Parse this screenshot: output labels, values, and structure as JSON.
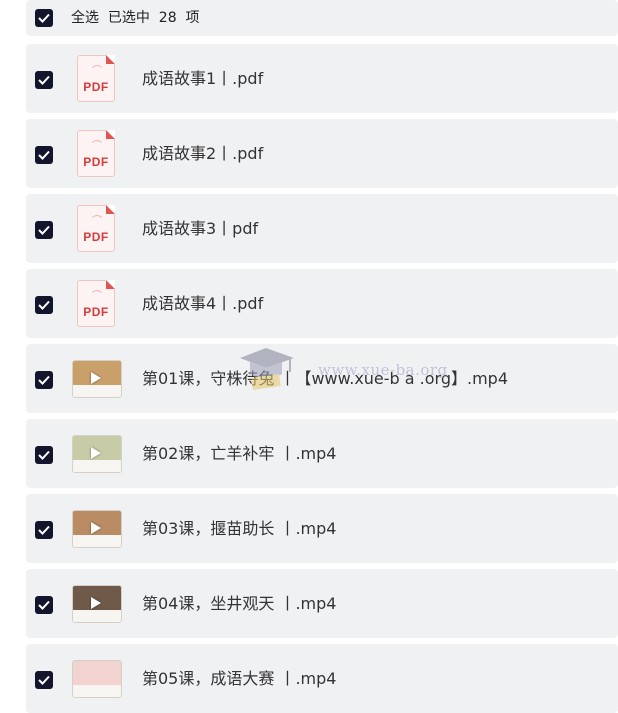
{
  "select_all": {
    "label": "全选  已选中  28  项",
    "checked": true
  },
  "files": [
    {
      "name": "成语故事1丨.pdf",
      "type": "pdf",
      "checked": true
    },
    {
      "name": "成语故事2丨.pdf",
      "type": "pdf",
      "checked": true
    },
    {
      "name": "成语故事3丨pdf",
      "type": "pdf",
      "checked": true
    },
    {
      "name": "成语故事4丨.pdf",
      "type": "pdf",
      "checked": true
    },
    {
      "name": "第01课，守株待兔 丨【www.xue-b a .org】.mp4",
      "type": "video",
      "checked": true,
      "thumb_color": "#c9a06a"
    },
    {
      "name": "第02课，亡羊补牢 丨.mp4",
      "type": "video",
      "checked": true,
      "thumb_color": "#c7cba6"
    },
    {
      "name": "第03课，揠苗助长 丨.mp4",
      "type": "video",
      "checked": true,
      "thumb_color": "#b98c63"
    },
    {
      "name": "第04课，坐井观天 丨.mp4",
      "type": "video",
      "checked": true,
      "thumb_color": "#6f5a49"
    },
    {
      "name": "第05课，成语大赛 丨.mp4",
      "type": "video",
      "checked": true,
      "thumb_color": "#f3d3cf"
    }
  ],
  "pdf_icon_label": "PDF",
  "watermark": {
    "text": "www.xue-ba.org"
  },
  "colors": {
    "row_bg": "#f0f1f3",
    "checkbox": "#12152b",
    "pdf_red": "#d83b3b"
  }
}
